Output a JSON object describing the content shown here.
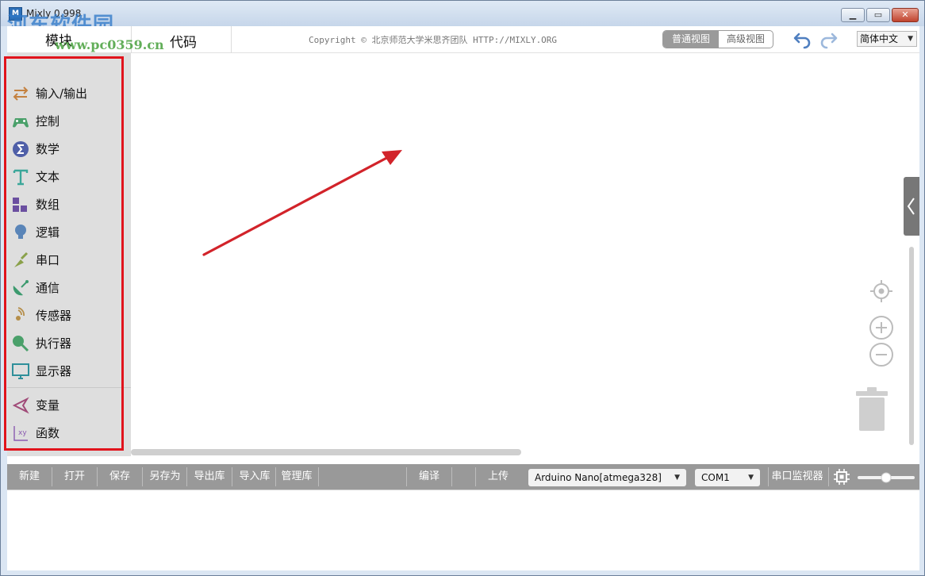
{
  "window": {
    "title": "Mixly 0.998",
    "app_icon_text": "M"
  },
  "watermark": {
    "text": "河东软件园",
    "url": "www.pc0359.cn"
  },
  "header": {
    "tab_blocks": "模块",
    "tab_code": "代码",
    "copyright": "Copyright © 北京师范大学米思齐团队 HTTP://MIXLY.ORG",
    "view_normal": "普通视图",
    "view_advanced": "高级视图",
    "language": "简体中文"
  },
  "toolbox": {
    "items": [
      {
        "label": "输入/输出",
        "icon": "io-arrows-icon"
      },
      {
        "label": "控制",
        "icon": "gamepad-icon"
      },
      {
        "label": "数学",
        "icon": "sigma-icon"
      },
      {
        "label": "文本",
        "icon": "text-t-icon"
      },
      {
        "label": "数组",
        "icon": "blocks-icon"
      },
      {
        "label": "逻辑",
        "icon": "bulb-icon"
      },
      {
        "label": "串口",
        "icon": "probe-icon"
      },
      {
        "label": "通信",
        "icon": "dish-icon"
      },
      {
        "label": "传感器",
        "icon": "sensor-icon"
      },
      {
        "label": "执行器",
        "icon": "actuator-icon"
      },
      {
        "label": "显示器",
        "icon": "monitor-icon"
      },
      {
        "label": "变量",
        "icon": "variable-icon"
      },
      {
        "label": "函数",
        "icon": "function-icon"
      }
    ]
  },
  "bottom_bar": {
    "new": "新建",
    "open": "打开",
    "save": "保存",
    "save_as": "另存为",
    "export_lib": "导出库",
    "import_lib": "导入库",
    "manage_lib": "管理库",
    "compile": "编译",
    "upload": "上传",
    "board": "Arduino Nano[atmega328]",
    "port": "COM1",
    "serial_monitor": "串口监视器"
  },
  "colors": {
    "highlight": "#e1131c",
    "arrow": "#d2232a",
    "bar": "#999999",
    "toolbox": "#dedede"
  }
}
